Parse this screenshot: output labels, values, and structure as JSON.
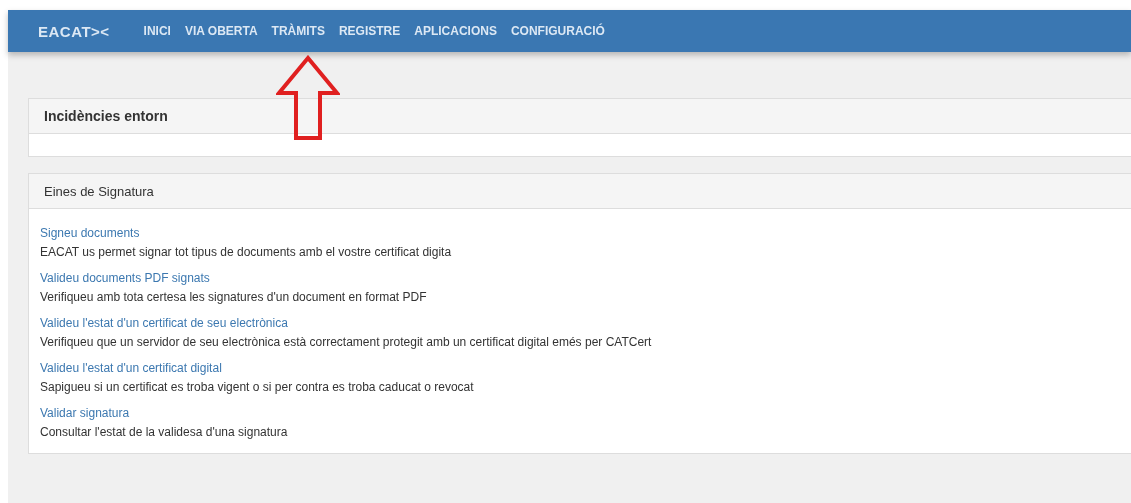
{
  "navbar": {
    "logo": "EACAT><",
    "items": [
      "INICI",
      "VIA OBERTA",
      "TRÀMITS",
      "REGISTRE",
      "APLICACIONS",
      "CONFIGURACIÓ"
    ]
  },
  "panels": [
    {
      "title": "Incidències entorn",
      "kind": "bold"
    },
    {
      "title": "Eines de Signatura",
      "kind": "plain",
      "entries": [
        {
          "link": "Signeu documents",
          "description": "EACAT us permet signar tot tipus de documents amb el vostre certificat digita"
        },
        {
          "link": "Valideu documents PDF signats",
          "description": "Verifiqueu amb tota certesa les signatures d'un document en format PDF"
        },
        {
          "link": "Valideu l'estat d'un certificat de seu electrònica",
          "description": "Verifiqueu que un servidor de seu electrònica està correctament protegit amb un certificat digital emés per CATCert"
        },
        {
          "link": "Valideu l'estat d'un certificat digital",
          "description": "Sapigueu si un certificat es troba vigent o si per contra es troba caducat o revocat"
        },
        {
          "link": "Validar signatura",
          "description": "Consultar l'estat de la validesa d'una signatura"
        }
      ]
    }
  ]
}
